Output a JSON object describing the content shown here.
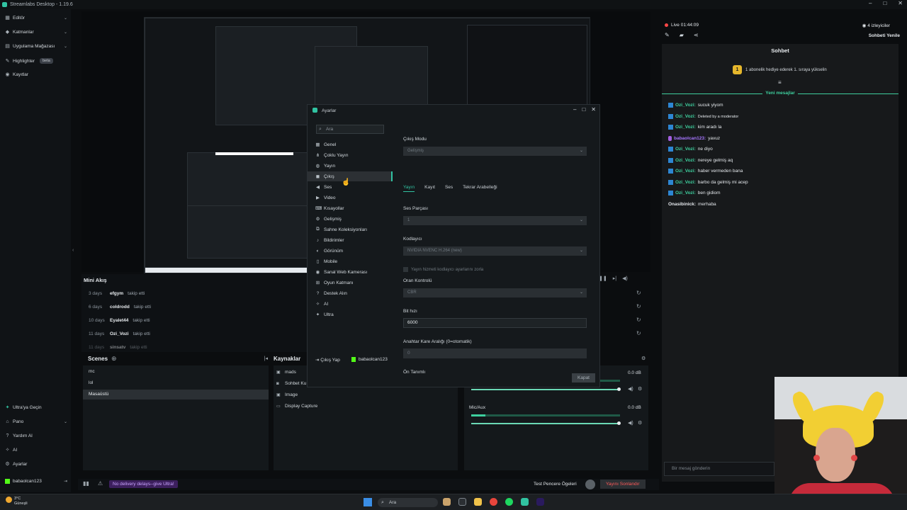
{
  "titlebar": {
    "title": "Streamlabs Desktop - 1.19.6"
  },
  "sidebar": {
    "top_items": [
      {
        "label": "Editör"
      },
      {
        "label": "Katmanlar"
      },
      {
        "label": "Uygulama Mağazası"
      },
      {
        "label": "Highlighter",
        "badge": "beta"
      },
      {
        "label": "Kayıtlar"
      }
    ],
    "bottom_items": [
      {
        "label": "Ultra'ya Geçin"
      },
      {
        "label": "Pano"
      },
      {
        "label": "Yardım Al"
      },
      {
        "label": "AI"
      },
      {
        "label": "Ayarlar"
      },
      {
        "label": "babaolcan123"
      }
    ]
  },
  "minifeed": {
    "title": "Mini Akış",
    "rows": [
      {
        "when": "3 days",
        "user": "efgym",
        "action": "takip etti"
      },
      {
        "when": "6 days",
        "user": "coldrodd",
        "action": "takip etti"
      },
      {
        "when": "10 days",
        "user": "Eyalet44",
        "action": "takip etti"
      },
      {
        "when": "11 days",
        "user": "Ozi_Vozi",
        "action": "takip etti"
      },
      {
        "when": "11 days",
        "user": "sinsatv",
        "action": "takip etti"
      }
    ]
  },
  "scenes": {
    "title": "Scenes",
    "items": [
      {
        "label": "mc",
        "selected": false
      },
      {
        "label": "lol",
        "selected": false
      },
      {
        "label": "Masaüstü",
        "selected": true
      }
    ]
  },
  "sources": {
    "title": "Kaynaklar",
    "items": [
      {
        "label": "mads"
      },
      {
        "label": "Sohbet Ku"
      },
      {
        "label": "Image"
      },
      {
        "label": "Display Capture"
      }
    ]
  },
  "mixer": {
    "channels": [
      {
        "label": "",
        "db": "0.0 dB"
      },
      {
        "label": "Mic/Aux",
        "db": "0.0 dB"
      }
    ]
  },
  "statusbar": {
    "delay": "No delivery delays--give Ultra!",
    "test_label": "Test Pencere Ögeleri",
    "end_label": "Yayını Sonlandır"
  },
  "dialog": {
    "title": "Ayarlar",
    "search_placeholder": "Ara",
    "nav": [
      {
        "label": "Genel"
      },
      {
        "label": "Çoklu Yayın"
      },
      {
        "label": "Yayın"
      },
      {
        "label": "Çıkış",
        "active": true
      },
      {
        "label": "Ses"
      },
      {
        "label": "Video"
      },
      {
        "label": "Kısayollar"
      },
      {
        "label": "Gelişmiş"
      },
      {
        "label": "Sahne Koleksiyonları"
      },
      {
        "label": "Bildirimler"
      },
      {
        "label": "Görünüm"
      },
      {
        "label": "Mobile"
      },
      {
        "label": "Sanal Web Kamerası"
      },
      {
        "label": "Oyun Katmanı"
      },
      {
        "label": "Destek Alın"
      },
      {
        "label": "AI"
      },
      {
        "label": "Ultra"
      }
    ],
    "footer": {
      "logout": "Çıkış Yap",
      "account": "babaolcan123"
    },
    "output_mode_label": "Çıkış Modu",
    "output_mode_value": "Gelişmiş",
    "tabs": [
      "Yayın",
      "Kayıt",
      "Ses",
      "Tekrar Arabelleği"
    ],
    "audio_track_label": "Ses Parçası",
    "audio_track_value": "1",
    "encoder_label": "Kodlayıcı",
    "encoder_value": "NVIDIA NVENC H.264 (new)",
    "enforce_label": "Yayın hizmeti kodlayıcı ayarlarını zorla",
    "rate_control_label": "Oran Kontrolü",
    "rate_control_value": "CBR",
    "bitrate_label": "Bit hızı",
    "bitrate_value": "6000",
    "keyframe_label": "Anahtar Kare Aralığı (0=otomatik)",
    "keyframe_value": "0",
    "preset_label": "Ön Tanımlı",
    "close_label": "Kapat"
  },
  "chat": {
    "live": "Live 01:44:09",
    "viewers": "4 izleyiciler",
    "refresh": "Sohbeti Yenile",
    "title": "Sohbet",
    "gift": "1 abonelik hediye ederek 1. sıraya yükselin",
    "new_messages": "Yeni mesajlar",
    "messages": [
      {
        "user": "Ozi_Vozi:",
        "text": "sucuk yiyom",
        "style": "green"
      },
      {
        "user": "Ozi_Vozi:",
        "text": "Deleted by a moderator",
        "style": "green"
      },
      {
        "user": "Ozi_Vozi:",
        "text": "kim aradı la",
        "style": "green"
      },
      {
        "user": "babaolcan123:",
        "text": "yavuz",
        "style": "purple"
      },
      {
        "user": "Ozi_Vozi:",
        "text": "ne diyo",
        "style": "green"
      },
      {
        "user": "Ozi_Vozi:",
        "text": "nereye gelmiş aq",
        "style": "green"
      },
      {
        "user": "Ozi_Vozi:",
        "text": "haber vermeden bana",
        "style": "green"
      },
      {
        "user": "Ozi_Vozi:",
        "text": "barbo da gelmiş mi acep",
        "style": "green"
      },
      {
        "user": "Ozi_Vozi:",
        "text": "ben gidiom",
        "style": "green"
      },
      {
        "user": "Onasibinick:",
        "text": "merhaba",
        "style": "white"
      }
    ],
    "input_placeholder": "Bir mesaj gönderin"
  },
  "taskbar": {
    "weather_temp": "3°C",
    "weather_desc": "Güneşli",
    "search": "Ara"
  }
}
